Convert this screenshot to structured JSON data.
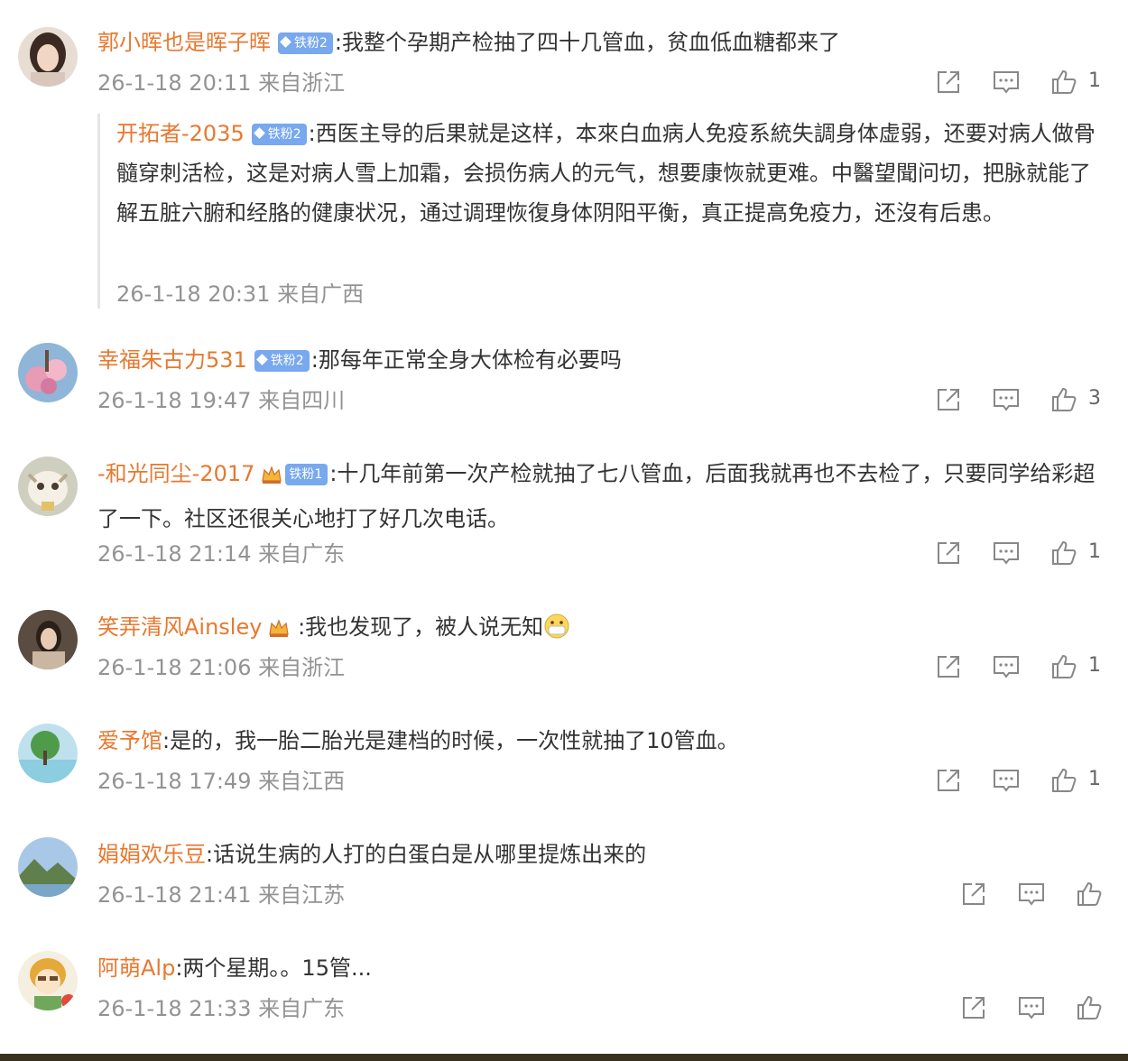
{
  "comments": [
    {
      "name": "郭小晖也是晖子晖",
      "badge": "铁粉2",
      "text": "我整个孕期产检抽了四十几管血，贫血低血糖都来了",
      "time": "26-1-18 20:11 来自浙江",
      "likes": "1",
      "reply": {
        "name": "开拓者-2035",
        "badge": "铁粉2",
        "text": "西医主导的后果就是这样，本來白血病人免疫系統失調身体虚弱，还要对病人做骨髓穿刺活检，这是对病人雪上加霜，会损伤病人的元气，想要康恢就更难。中醫望聞问切，把脉就能了解五脏六腑和经胳的健康状况，通过调理恢復身体阴阳平衡，真正提高免疫力，还沒有后患。",
        "time": "26-1-18 20:31 来自广西"
      }
    },
    {
      "name": "幸福朱古力531",
      "badge": "铁粉2",
      "text": "那每年正常全身大体检有必要吗",
      "time": "26-1-18 19:47 来自四川",
      "likes": "3"
    },
    {
      "name": "-和光同尘-2017",
      "badge": "铁粉1",
      "text": "十几年前第一次产检就抽了七八管血，后面我就再也不去检了，只要同学给彩超了一下。社区还很关心地打了好几次电话。",
      "time": "26-1-18 21:14 来自广东",
      "likes": "1"
    },
    {
      "name": "笑弄清风Ainsley",
      "text": "我也发现了，被人说无知",
      "time": "26-1-18 21:06 来自浙江",
      "likes": "1"
    },
    {
      "name": "爱予馆",
      "text": "是的，我一胎二胎光是建档的时候，一次性就抽了10管血。",
      "time": "26-1-18 17:49 来自江西",
      "likes": "1"
    },
    {
      "name": "娟娟欢乐豆",
      "text": "话说生病的人打的白蛋白是从哪里提炼出来的",
      "time": "26-1-18 21:41 来自江苏"
    },
    {
      "name": "阿萌Alp",
      "text": "两个星期。。15管...",
      "time": "26-1-18 21:33 来自广东"
    }
  ],
  "colors": {
    "name": "#e8782f",
    "meta": "#939393",
    "badge": "#78a8ee",
    "text": "#333333"
  },
  "icons": [
    "share-icon",
    "comment-icon",
    "like-icon",
    "crown-icon",
    "diamond-icon",
    "mask-emoji-icon"
  ]
}
